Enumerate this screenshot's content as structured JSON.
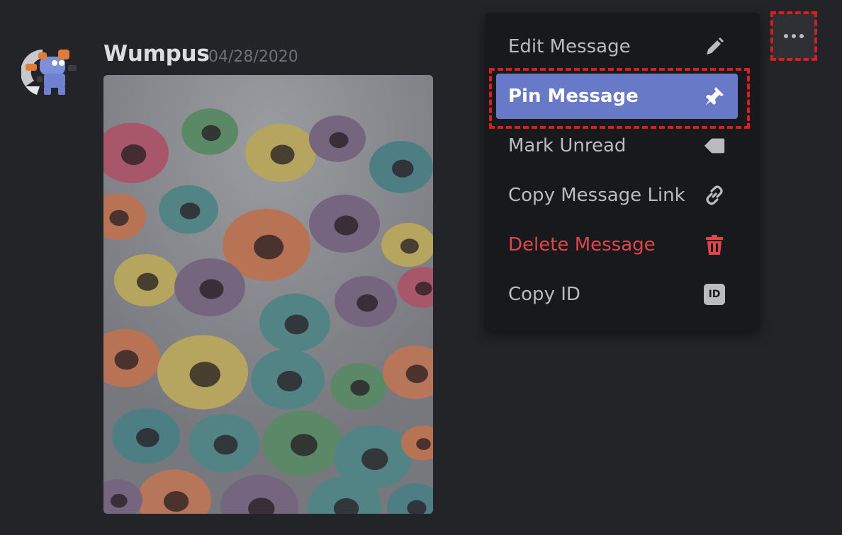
{
  "message": {
    "author": "Wumpus",
    "timestamp": "04/28/2020",
    "attachment": "cereal-photo"
  },
  "more_button": {
    "icon": "more-horizontal-icon"
  },
  "context_menu": {
    "items": [
      {
        "label": "Edit Message",
        "icon": "pencil-icon",
        "active": false,
        "danger": false
      },
      {
        "label": "Pin Message",
        "icon": "pin-icon",
        "active": true,
        "danger": false
      },
      {
        "label": "Mark Unread",
        "icon": "tag-icon",
        "active": false,
        "danger": false
      },
      {
        "label": "Copy Message Link",
        "icon": "link-icon",
        "active": false,
        "danger": false
      },
      {
        "label": "Delete Message",
        "icon": "trash-icon",
        "active": false,
        "danger": true
      },
      {
        "label": "Copy ID",
        "icon": "id-icon",
        "active": false,
        "danger": false,
        "badge": "ID"
      }
    ]
  },
  "colors": {
    "background": "#232427",
    "menu_background": "#18191c",
    "accent": "#6779c7",
    "danger": "#e0454a",
    "highlight_outline": "#d71f1f"
  }
}
